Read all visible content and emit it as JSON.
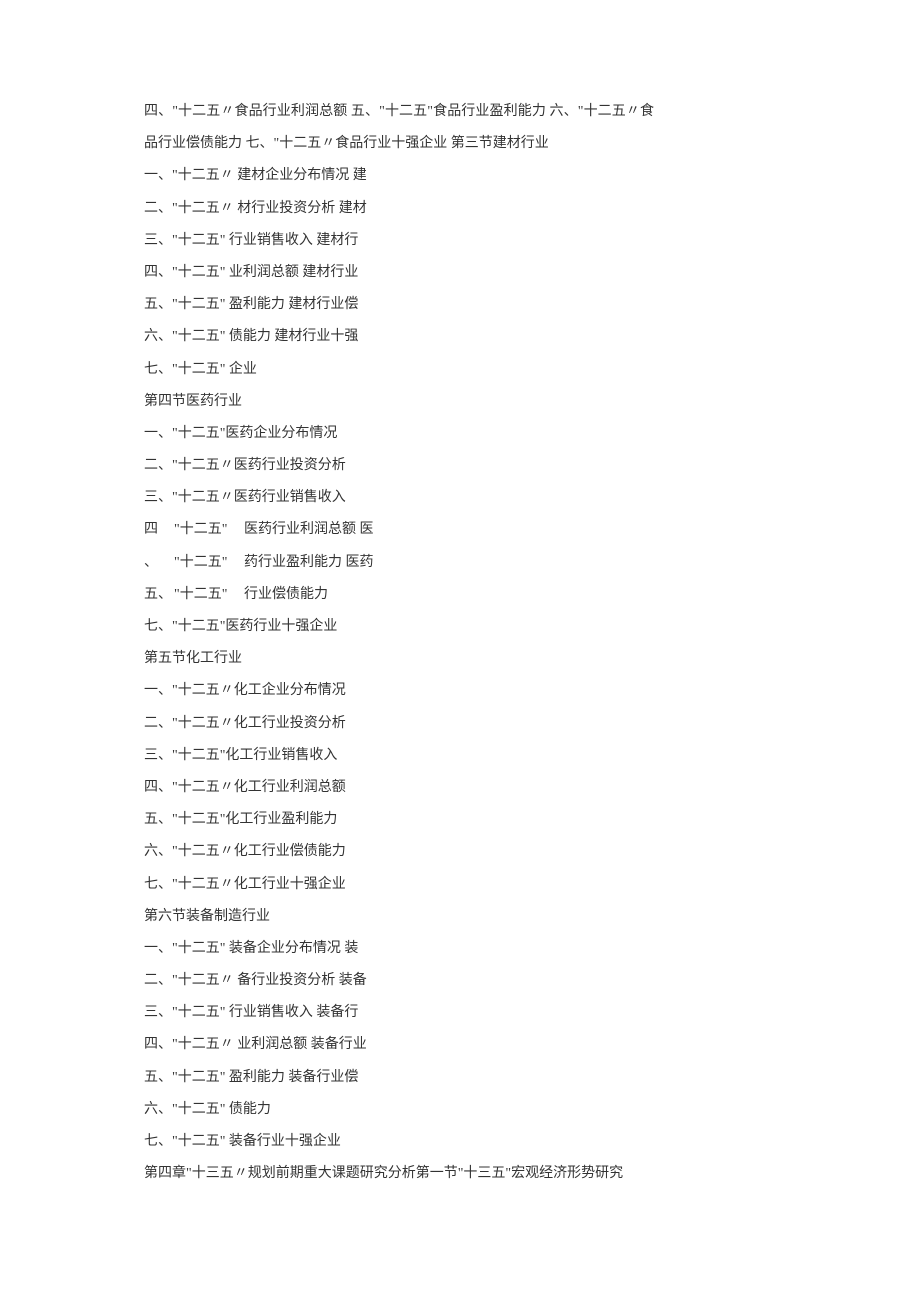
{
  "intro": "四、\"十二五〃食品行业利润总额 五、\"十二五\"食品行业盈利能力 六、\"十二五〃食品行业偿债能力 七、\"十二五〃食品行业十强企业 第三节建材行业",
  "jc": {
    "l1": "一、\"十二五〃  建材企业分布情况 建",
    "l2": "二、\"十二五〃  材行业投资分析 建材",
    "l3": "三、\"十二五\"  行业销售收入 建材行",
    "l4": "四、\"十二五\"  业利润总额 建材行业",
    "l5": "五、\"十二五\"  盈利能力 建材行业偿",
    "l6": "六、\"十二五\"  债能力 建材行业十强",
    "l7": "七、\"十二五\"  企业"
  },
  "s4h": "第四节医药行业",
  "yy": {
    "l1": "一、\"十二五\"医药企业分布情况",
    "l2": "二、\"十二五〃医药行业投资分析",
    "l3": "三、\"十二五〃医药行业销售收入",
    "r4c0": "四",
    "r4c1": "\"十二五\"",
    "r4c2": "医药行业利润总额 医",
    "r5c0": "、",
    "r5c1": "\"十二五\"",
    "r5c2": "药行业盈利能力 医药",
    "r6c0": "五、",
    "r6c1": "\"十二五\"",
    "r6c2": "行业偿债能力",
    "l7": "七、\"十二五\"医药行业十强企业"
  },
  "s5h": "第五节化工行业",
  "hg": {
    "l1": "一、\"十二五〃化工企业分布情况",
    "l2": "二、\"十二五〃化工行业投资分析",
    "l3": "三、\"十二五\"化工行业销售收入",
    "l4": "四、\"十二五〃化工行业利润总额",
    "l5": "五、\"十二五\"化工行业盈利能力",
    "l6": "六、\"十二五〃化工行业偿债能力",
    "l7": "七、\"十二五〃化工行业十强企业"
  },
  "s6h": "第六节装备制造行业",
  "zb": {
    "l1": "一、\"十二五\"  装备企业分布情况 装",
    "l2": "二、\"十二五〃  备行业投资分析 装备",
    "l3": "三、\"十二五\"  行业销售收入 装备行",
    "l4": "四、\"十二五〃  业利润总额 装备行业",
    "l5": "五、\"十二五\"  盈利能力 装备行业偿",
    "l6": "六、\"十二五\"  债能力",
    "l7": "七、\"十二五\"  装备行业十强企业"
  },
  "ch4": "第四章\"十三五〃规划前期重大课题研究分析第一节\"十三五\"宏观经济形势研究"
}
